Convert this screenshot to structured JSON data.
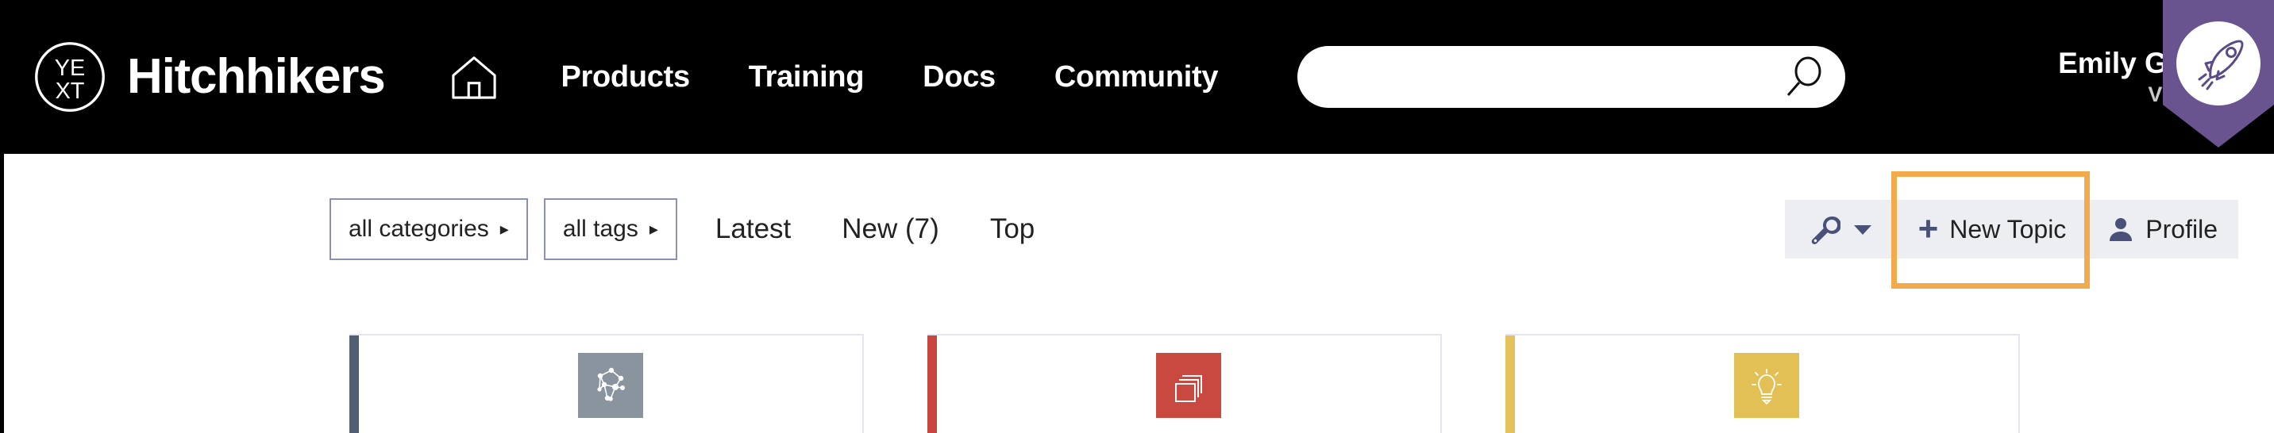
{
  "header": {
    "brand_name": "Hitchhikers",
    "logo_text_top": "YE",
    "logo_text_bottom": "XT",
    "home_icon": "home-icon",
    "nav": [
      {
        "label": "Products"
      },
      {
        "label": "Training"
      },
      {
        "label": "Docs"
      },
      {
        "label": "Community"
      }
    ],
    "search": {
      "value": "",
      "placeholder": "",
      "icon": "search-icon"
    },
    "user": {
      "name": "Emily Green",
      "rank": "VIKING",
      "caret_icon": "chevron-down-icon",
      "badge_icon": "rocket-icon",
      "badge_color": "#6a5490"
    },
    "background_color": "#000000"
  },
  "toolbar": {
    "filters": [
      {
        "label": "all categories",
        "caret": "▸"
      },
      {
        "label": "all tags",
        "caret": "▸"
      }
    ],
    "sort_links": [
      {
        "label": "Latest"
      },
      {
        "label": "New (7)"
      },
      {
        "label": "Top"
      }
    ],
    "wrench_label": "",
    "wrench_icon": "wrench-icon",
    "wrench_caret_icon": "caret-down-icon",
    "new_topic_label": "New Topic",
    "new_topic_plus": "+",
    "profile_label": "Profile",
    "profile_icon": "user-icon",
    "highlight_color": "#f2aa4c",
    "group_background": "#eceef1",
    "accent_navy": "#4a5178",
    "filter_border": "#8c91b4"
  },
  "cards": [
    {
      "accent_color": "#4e6072",
      "tile_color": "#8a949e",
      "icon": "network-graph-icon"
    },
    {
      "accent_color": "#c9463f",
      "tile_color": "#c9483f",
      "icon": "stacked-cards-icon"
    },
    {
      "accent_color": "#e5c25b",
      "tile_color": "#e3c055",
      "icon": "lightbulb-icon"
    }
  ]
}
